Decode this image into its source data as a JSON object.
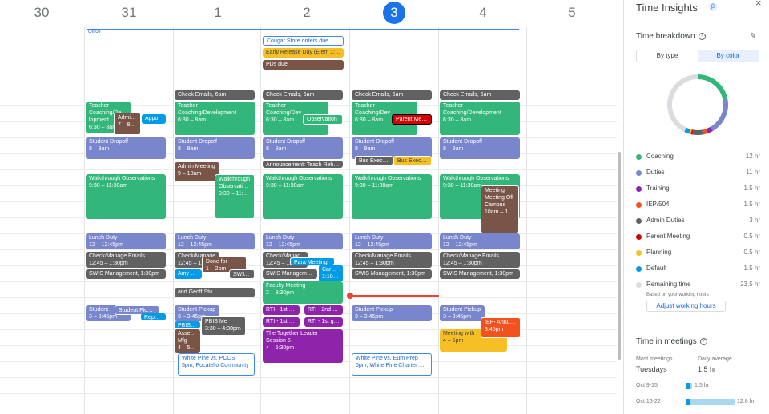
{
  "day_headers": [
    "30",
    "31",
    "1",
    "2",
    "3",
    "4",
    "5"
  ],
  "allday": {
    "office": "Office",
    "cougar": "Cougar Store orders due",
    "early": "Early Release Day (Elem 1:35)",
    "pds": "PDs due"
  },
  "events": {
    "d31_teacher": [
      "Teacher",
      "Coaching/De",
      "lopment",
      "6:30 – 8am"
    ],
    "d31_admin": [
      "Admin M",
      "7 – 8am"
    ],
    "d31_appt": "Appo",
    "d31_dropoff": [
      "Student Dropoff",
      "8 – 9am"
    ],
    "d31_walk": [
      "Walkthrough Observations",
      "9:30 – 11:30am"
    ],
    "d31_lunch": [
      "Lunch Duty",
      "12 – 12:45pm"
    ],
    "d31_check": [
      "Check/Manage Emails",
      "12:45 – 1:30pm"
    ],
    "d31_swis": "SWIS Management, 1:30pm",
    "d31_pickup": [
      "Student",
      "3 – 3:45pm"
    ],
    "d31_pickup2": "Student Pick up",
    "d31_report": "Report C",
    "d1_check6": "Check Emails, 6am",
    "d1_teacher": [
      "Teacher",
      "Coaching/Development",
      "6:30 – 8am"
    ],
    "d1_dropoff": [
      "Student Dropoff",
      "8 – 9am"
    ],
    "d1_brown": [
      "Admin Meeting",
      "9 – 10am"
    ],
    "d1_walk": [
      "Walkthrough",
      "Observations",
      "9:30 – 11:30am"
    ],
    "d1_lunch": [
      "Lunch Duty",
      "12 – 12:45pm"
    ],
    "d1_check": [
      "Check/Manage",
      "12:45 – 1:30"
    ],
    "d1_done": [
      "Done for",
      "1 – 2pm"
    ],
    "d1_swis": "SWIS Mana",
    "d1_any": "Amy Wa",
    "d1_geoff": "and Geoff Stu",
    "d1_pickup": [
      "Student Pickup",
      "3 – 3:45pm"
    ],
    "d1_pbis": [
      "PBIS Me",
      "3:30 – 4:30pm"
    ],
    "d1_pbisb": "PBIS MEETI",
    "d1_assess": [
      "Assessm",
      "Mfg",
      "4 – 5pm"
    ],
    "d1_wp": [
      "White Pine vs. PCCS",
      "5pm, Pocatello Community"
    ],
    "d2_check6": "Check Emails, 6am",
    "d2_teacher": [
      "Teacher",
      "Coaching/Dev",
      "6:30 – 8am"
    ],
    "d2_teacher2": "Observation",
    "d2_dropoff": [
      "Student Dropoff",
      "8 – 9am"
    ],
    "d2_announce": "Announcement: Teach Rehearsal",
    "d2_walk": [
      "Walkthrough Observations",
      "9:30 – 11:30am"
    ],
    "d2_lunch": [
      "Lunch Duty",
      "12 – 12:45pm"
    ],
    "d2_check": [
      "Check/Manag",
      "12:45 – 1:30"
    ],
    "d2_para": "Para Meeting",
    "d2_carpool": [
      "Carpool",
      "1:10 – 2"
    ],
    "d2_swis": "SWIS Management, 1:30pm",
    "d2_faculty": [
      "Faculty Meeting",
      "2 – 3:30pm"
    ],
    "d2_rti1": "RTI - 1st grad",
    "d2_rti2": "RTI - 2nd gra",
    "d2_rti3": "RTI - 1st grade",
    "d2_rti4": "RTI - 1st grad",
    "d2_together": [
      "The Together Leader",
      "Session 5",
      "4 – 5:30pm"
    ],
    "d3_check6": "Check Emails, 6am",
    "d3_teacher": [
      "Teacher",
      "Coaching/Dev",
      "6:30 – 8am"
    ],
    "d3_red": "Parent Meeting",
    "d3_dropoff": [
      "Student Dropoff",
      "8 – 9am"
    ],
    "d3_bus1": "Bus Exec Dri",
    "d3_bus2": "Bus Exec Dri",
    "d3_walk": [
      "Walkthrough Observations",
      "9:30 – 11:30am"
    ],
    "d3_lunch": [
      "Lunch Duty",
      "12 – 12:45pm"
    ],
    "d3_check": [
      "Check/Manage Emails",
      "12:45 – 1:30pm"
    ],
    "d3_swis": "SWIS Management, 1:30pm",
    "d3_pickup": [
      "Student Pickup",
      "3 – 3:45pm"
    ],
    "d3_wp": [
      "White Pine vs. Eum Prep",
      "5pm, White Pine Charter Sch"
    ],
    "d4_check6": "Check Emails, 6am",
    "d4_teacher": [
      "Teacher",
      "Coaching/Development",
      "6:30 – 8am"
    ],
    "d4_dropoff": [
      "Student Dropoff",
      "8 – 9am"
    ],
    "d4_walk": [
      "Walkthrough Observations",
      "9:30 – 11:30am"
    ],
    "d4_meeting": [
      "Meeting",
      "Meeting Off",
      "Campus",
      "10am – 12:15pm"
    ],
    "d4_lunch": [
      "Lunch Duty",
      "12 – 12:45pm"
    ],
    "d4_check": [
      "Check/Manage Emails",
      "12:45 – 1:30pm"
    ],
    "d4_swis": "SWIS Management, 1:30pm",
    "d4_pickup": [
      "Student Pickup",
      "3 – 3:45pm"
    ],
    "d4_mwith": [
      "Meeting with",
      "4 – 5pm"
    ],
    "d4_iep": [
      "IEP- Annual R",
      "3:45pm"
    ]
  },
  "sidebar": {
    "title": "Time Insights",
    "beta_icon": "beta-badge-icon",
    "close": "×",
    "breakdown_title": "Time breakdown",
    "by_type": "By type",
    "by_color": "By color",
    "legend": [
      {
        "label": "Coaching",
        "value": "12 hr",
        "color": "#33b679",
        "hours": 12
      },
      {
        "label": "Duties",
        "value": "11 hr",
        "color": "#7986cb",
        "hours": 11
      },
      {
        "label": "Training",
        "value": "1.5 hr",
        "color": "#8e24aa",
        "hours": 1.5
      },
      {
        "label": "IEP/504",
        "value": "1.5 hr",
        "color": "#f4511e",
        "hours": 1.5
      },
      {
        "label": "Admin Duties",
        "value": "3 hr",
        "color": "#616161",
        "hours": 3
      },
      {
        "label": "Parent Meeting",
        "value": "0.5 hr",
        "color": "#d50000",
        "hours": 0.5
      },
      {
        "label": "Planning",
        "value": "0.5 hr",
        "color": "#f6bf26",
        "hours": 0.5
      },
      {
        "label": "Default",
        "value": "1.5 hr",
        "color": "#039be5",
        "hours": 1.5
      },
      {
        "label": "Remaining time",
        "value": "23.5 hr",
        "color": "#dadce0",
        "hours": 23.5
      }
    ],
    "remaining_note": "Based on your working hours",
    "adjust_button": "Adjust working hours",
    "meetings_title": "Time in meetings",
    "most_label": "Most meetings",
    "most_value": "Tuesdays",
    "avg_label": "Daily average",
    "avg_value": "1.5 hr",
    "weeks": [
      {
        "label": "Oct 9-15",
        "value": "1.5 hr",
        "fraction": 0.12
      },
      {
        "label": "Oct 16-22",
        "value": "12.8 hr",
        "fraction": 1.0
      }
    ]
  }
}
